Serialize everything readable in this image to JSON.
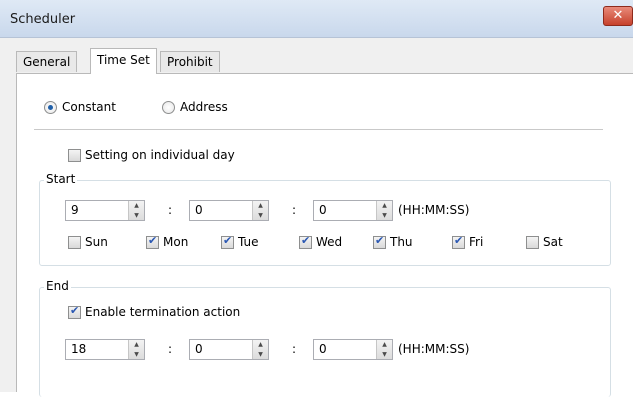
{
  "window": {
    "title": "Scheduler",
    "close_label": "✕"
  },
  "tabs": [
    {
      "label": "General",
      "active": false
    },
    {
      "label": "Time Set",
      "active": true
    },
    {
      "label": "Prohibit",
      "active": false
    }
  ],
  "source": {
    "constant_label": "Constant",
    "address_label": "Address",
    "selected": "Constant"
  },
  "individual_day": {
    "label": "Setting on individual day",
    "checked": false
  },
  "start": {
    "legend": "Start",
    "hh": "9",
    "mm": "0",
    "ss": "0",
    "separator": ":",
    "format_label": "(HH:MM:SS)",
    "days": [
      {
        "label": "Sun",
        "checked": false
      },
      {
        "label": "Mon",
        "checked": true
      },
      {
        "label": "Tue",
        "checked": true
      },
      {
        "label": "Wed",
        "checked": true
      },
      {
        "label": "Thu",
        "checked": true
      },
      {
        "label": "Fri",
        "checked": true
      },
      {
        "label": "Sat",
        "checked": false
      }
    ]
  },
  "end": {
    "legend": "End",
    "termination_label": "Enable termination action",
    "termination_checked": true,
    "hh": "18",
    "mm": "0",
    "ss": "0",
    "separator": ":",
    "format_label": "(HH:MM:SS)"
  }
}
